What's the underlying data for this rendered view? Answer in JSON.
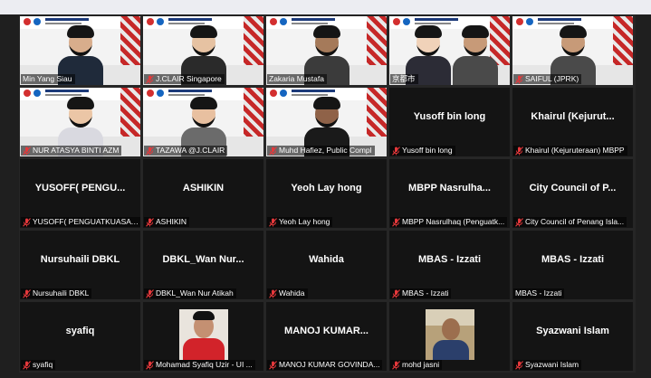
{
  "meeting": {
    "tiles": [
      {
        "name": "Min Yang Siau",
        "video": true,
        "muted": false
      },
      {
        "name": "J.CLAIR Singapore",
        "video": true,
        "muted": true
      },
      {
        "name": "Zakaria Mustafa",
        "video": true,
        "muted": false
      },
      {
        "name": "京都市",
        "video": true,
        "muted": false,
        "active": true
      },
      {
        "name": "SAIFUL (JPRK)",
        "video": true,
        "muted": true
      },
      {
        "name": "NUR ATASYA BINTI AZM",
        "video": true,
        "muted": true
      },
      {
        "name": "TAZAWA @J.CLAIR",
        "video": true,
        "muted": true
      },
      {
        "name": "Muhd Hafiez, Public Compl",
        "video": true,
        "muted": true
      },
      {
        "name": "Yusoff bin long",
        "display": "Yusoff bin long",
        "muted": true
      },
      {
        "name": "Khairul (Kejuruteraan) MBPP",
        "display": "Khairul  (Kejurut...",
        "muted": true
      },
      {
        "name": "YUSOFF( PENGUATKUASA ...",
        "display": "YUSOFF( PENGU...",
        "muted": true
      },
      {
        "name": "ASHIKIN",
        "display": "ASHIKIN",
        "muted": true
      },
      {
        "name": "Yeoh Lay hong",
        "display": "Yeoh Lay hong",
        "muted": true
      },
      {
        "name": "MBPP Nasrulhaq (Penguatk...",
        "display": "MBPP  Nasrulha...",
        "muted": true
      },
      {
        "name": "City Council of Penang Isla...",
        "display": "City Council of P...",
        "muted": true
      },
      {
        "name": "Nursuhaili DBKL",
        "display": "Nursuhaili DBKL",
        "muted": true
      },
      {
        "name": "DBKL_Wan Nur Atikah",
        "display": "DBKL_Wan  Nur...",
        "muted": true
      },
      {
        "name": "Wahida",
        "display": "Wahida",
        "muted": true
      },
      {
        "name": "MBAS - Izzati",
        "display": "MBAS - Izzati",
        "muted": true
      },
      {
        "name": "MBAS - Izzati",
        "display": "MBAS - Izzati",
        "muted": false
      },
      {
        "name": "syafiq",
        "display": "syafiq",
        "muted": true
      },
      {
        "name": "Mohamad Syafiq Uzir - UI ...",
        "photo": "red-shirt",
        "muted": true
      },
      {
        "name": "MANOJ KUMAR GOVINDA...",
        "display": "MANOJ  KUMAR...",
        "muted": true
      },
      {
        "name": "mohd jasni",
        "photo": "office",
        "muted": true
      },
      {
        "name": "Syazwani Islam",
        "display": "Syazwani Islam",
        "muted": true
      }
    ]
  },
  "colors": {
    "active_border": "#c8d23e",
    "muted_red": "#e5383b",
    "tile_bg": "#141414"
  }
}
